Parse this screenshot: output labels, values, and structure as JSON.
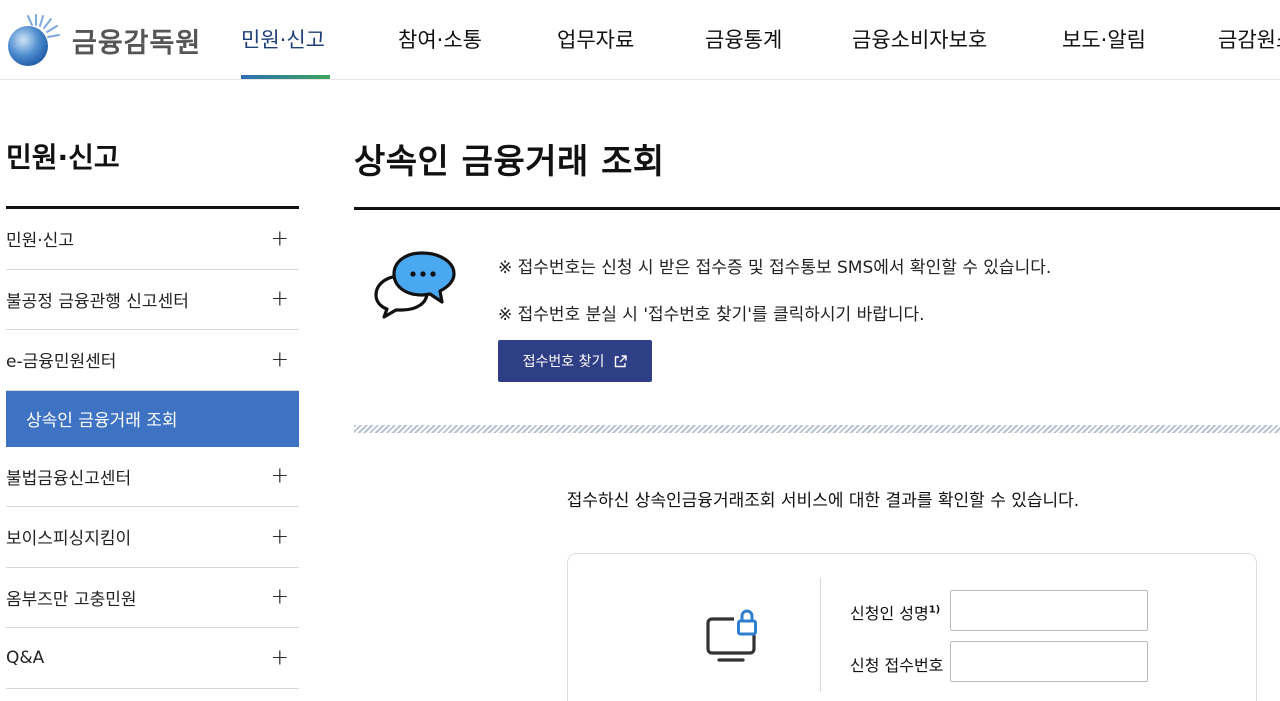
{
  "header": {
    "logo_text": "금융감독원",
    "nav": [
      {
        "label": "민원·신고",
        "active": true
      },
      {
        "label": "참여·소통",
        "active": false
      },
      {
        "label": "업무자료",
        "active": false
      },
      {
        "label": "금융통계",
        "active": false
      },
      {
        "label": "금융소비자보호",
        "active": false
      },
      {
        "label": "보도·알림",
        "active": false
      },
      {
        "label": "금감원소개",
        "active": false
      }
    ]
  },
  "sidebar": {
    "title": "민원·신고",
    "items": [
      {
        "label": "민원·신고",
        "active": false
      },
      {
        "label": "불공정 금융관행 신고센터",
        "active": false
      },
      {
        "label": "e-금융민원센터",
        "active": false
      },
      {
        "label": "상속인 금융거래 조회",
        "active": true
      },
      {
        "label": "불법금융신고센터",
        "active": false
      },
      {
        "label": "보이스피싱지킴이",
        "active": false
      },
      {
        "label": "옴부즈만 고충민원",
        "active": false
      },
      {
        "label": "Q&A",
        "active": false
      }
    ],
    "expand_symbol": "+"
  },
  "main": {
    "title": "상속인 금융거래 조회",
    "notices": [
      "※ 접수번호는 신청 시 받은 접수증 및 접수통보 SMS에서 확인할 수 있습니다.",
      "※ 접수번호 분실 시 '접수번호 찾기'를 클릭하시기 바랍니다."
    ],
    "find_button": "접수번호 찾기",
    "result_desc": "접수하신 상속인금융거래조회 서비스에 대한 결과를 확인할 수 있습니다.",
    "form": {
      "name_label": "신청인 성명",
      "name_footnote": "1)",
      "name_value": "",
      "receipt_label": "신청 접수번호",
      "receipt_value": ""
    }
  },
  "colors": {
    "brand_navy": "#2e3f86",
    "active_blue": "#3e73c4",
    "nav_active": "#1f3f7a"
  },
  "icons": [
    "logo-globe-icon",
    "chat-bubbles-icon",
    "external-link-icon",
    "monitor-lock-icon"
  ]
}
